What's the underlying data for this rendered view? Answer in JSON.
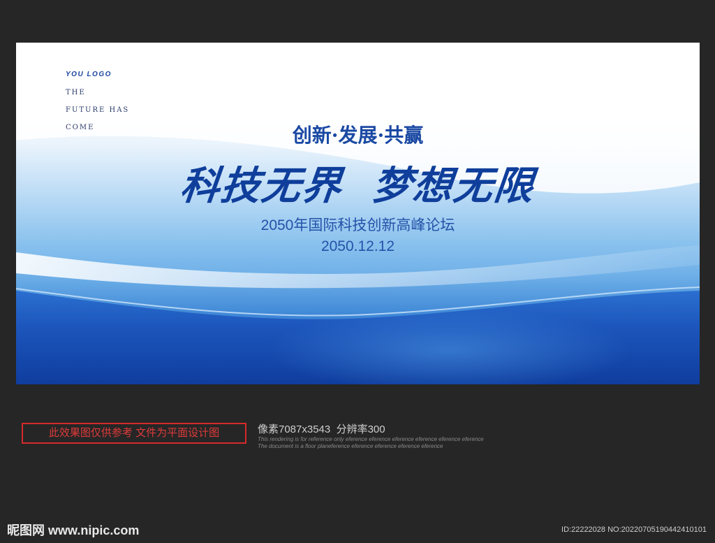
{
  "banner": {
    "logo": "YOU LOGO",
    "tagline_lines": [
      "THE",
      "FUTURE HAS",
      "COME"
    ],
    "subhead": "创新·发展·共赢",
    "headline": "科技无界  梦想无限",
    "forum_title": "2050年国际科技创新高峰论坛",
    "date": "2050.12.12",
    "colors": {
      "primary_blue": "#0f3e9b",
      "deep_blue": "#1a56b8",
      "light_blue": "#8cc3ee"
    }
  },
  "footer": {
    "notice": "此效果图仅供参考 文件为平面设计图",
    "specs": "像素7087x3543  分辨率300",
    "fine_print_1": "This rendering is for reference only  eference eference eference eference eference eference",
    "fine_print_2": "The document is a floor planeference eference eference eference eference",
    "brand": "昵图网 www.nipic.com",
    "id": "ID:22222028 NO:20220705190442410101"
  }
}
